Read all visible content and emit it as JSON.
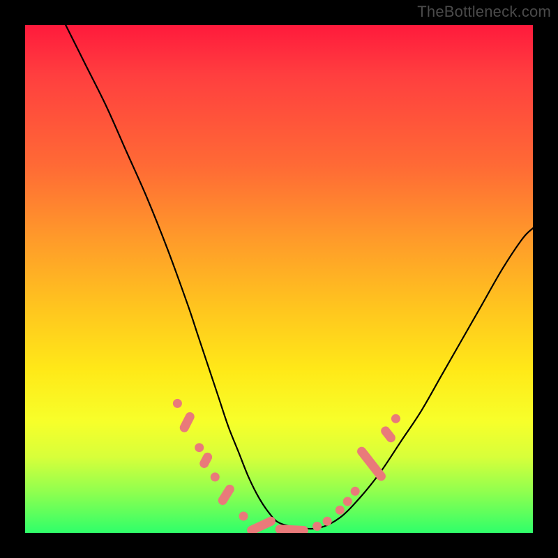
{
  "watermark": "TheBottleneck.com",
  "chart_data": {
    "type": "line",
    "title": "",
    "xlabel": "",
    "ylabel": "",
    "xlim": [
      0,
      100
    ],
    "ylim": [
      0,
      100
    ],
    "series": [
      {
        "name": "curve",
        "x": [
          8,
          12,
          16,
          20,
          24,
          28,
          32,
          34,
          36,
          38,
          40,
          42,
          44,
          46,
          48,
          50,
          54,
          58,
          62,
          66,
          70,
          74,
          78,
          82,
          86,
          90,
          94,
          98,
          100
        ],
        "y": [
          100,
          92,
          84,
          75,
          66,
          56,
          45,
          39,
          33,
          27,
          21,
          16,
          11,
          7,
          4,
          2,
          1,
          1,
          3,
          7,
          12,
          18,
          24,
          31,
          38,
          45,
          52,
          58,
          60
        ]
      }
    ],
    "markers": [
      {
        "shape": "dot",
        "x": 30.0,
        "y": 25.5
      },
      {
        "shape": "pill",
        "angle": 63,
        "x": 31.9,
        "y": 21.8,
        "len": 4.2
      },
      {
        "shape": "dot",
        "x": 34.3,
        "y": 16.8
      },
      {
        "shape": "pill",
        "angle": 62,
        "x": 35.6,
        "y": 14.3,
        "len": 3.2
      },
      {
        "shape": "dot",
        "x": 37.4,
        "y": 11.0
      },
      {
        "shape": "pill",
        "angle": 58,
        "x": 39.6,
        "y": 7.5,
        "len": 4.4
      },
      {
        "shape": "dot",
        "x": 43.0,
        "y": 3.3
      },
      {
        "shape": "pill",
        "angle": 25,
        "x": 46.5,
        "y": 1.4,
        "len": 6.0
      },
      {
        "shape": "pill",
        "angle": -3,
        "x": 52.5,
        "y": 0.6,
        "len": 6.5
      },
      {
        "shape": "dot",
        "x": 57.5,
        "y": 1.3
      },
      {
        "shape": "dot",
        "x": 59.5,
        "y": 2.3
      },
      {
        "shape": "dot",
        "x": 62.0,
        "y": 4.5
      },
      {
        "shape": "dot",
        "x": 63.5,
        "y": 6.2
      },
      {
        "shape": "dot",
        "x": 65.0,
        "y": 8.2
      },
      {
        "shape": "pill",
        "angle": -52,
        "x": 68.2,
        "y": 13.6,
        "len": 8.0
      },
      {
        "shape": "pill",
        "angle": -52,
        "x": 71.5,
        "y": 19.4,
        "len": 3.5
      },
      {
        "shape": "dot",
        "x": 73.0,
        "y": 22.5
      }
    ]
  }
}
